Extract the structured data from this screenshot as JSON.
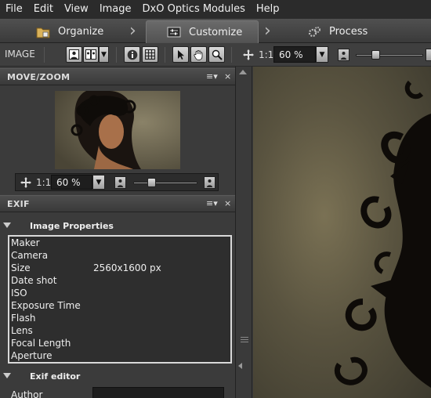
{
  "menu": [
    "File",
    "Edit",
    "View",
    "Image",
    "DxO Optics Modules",
    "Help"
  ],
  "workflow": {
    "organize": "Organize",
    "customize": "Customize",
    "process": "Process"
  },
  "toolbar": {
    "label": "IMAGE",
    "zoom_label": "1:1",
    "zoom_value": "60 %"
  },
  "move_zoom": {
    "title": "MOVE/ZOOM",
    "zoom_label": "1:1",
    "zoom_value": "60 %"
  },
  "exif": {
    "title": "EXIF",
    "image_properties_title": "Image Properties",
    "properties": [
      {
        "name": "Maker",
        "value": ""
      },
      {
        "name": "Camera",
        "value": ""
      },
      {
        "name": "Size",
        "value": "2560x1600 px"
      },
      {
        "name": "Date shot",
        "value": ""
      },
      {
        "name": "ISO",
        "value": ""
      },
      {
        "name": "Exposure Time",
        "value": ""
      },
      {
        "name": "Flash",
        "value": ""
      },
      {
        "name": "Lens",
        "value": ""
      },
      {
        "name": "Focal Length",
        "value": ""
      },
      {
        "name": "Aperture",
        "value": ""
      }
    ],
    "editor_title": "Exif editor",
    "author_label": "Author",
    "author_value": ""
  },
  "panel_controls": {
    "menu": "≡▾",
    "close": "×"
  }
}
